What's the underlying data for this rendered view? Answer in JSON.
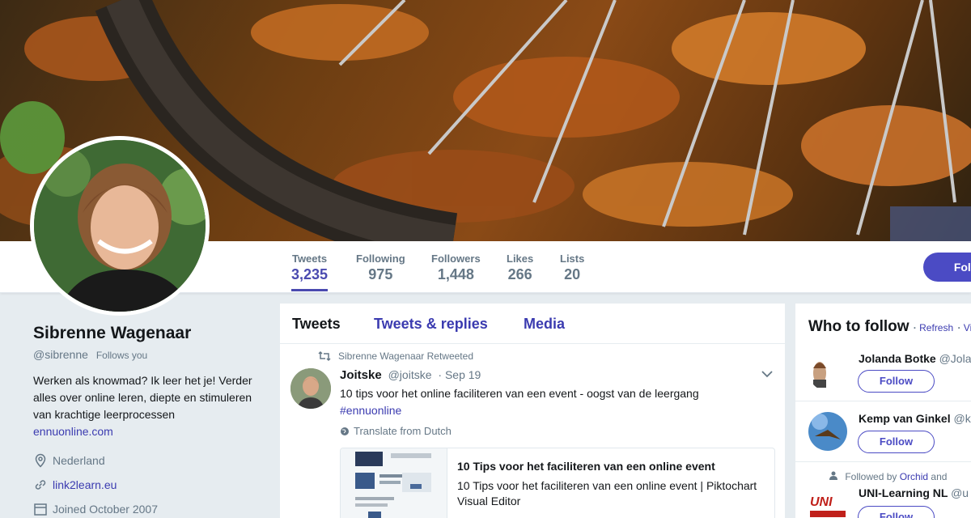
{
  "stats": [
    {
      "label": "Tweets",
      "value": "3,235"
    },
    {
      "label": "Following",
      "value": "975"
    },
    {
      "label": "Followers",
      "value": "1,448"
    },
    {
      "label": "Likes",
      "value": "266"
    },
    {
      "label": "Lists",
      "value": "20"
    }
  ],
  "header": {
    "follow_label": "Follow"
  },
  "profile": {
    "name": "Sibrenne Wagenaar",
    "handle": "@sibrenne",
    "follows_you": "Follows you",
    "bio": "Werken als knowmad? Ik leer het je! Verder alles over online leren, diepte en stimuleren van krachtige leerprocessen",
    "bio_link": "ennuonline.com",
    "location": "Nederland",
    "website": "link2learn.eu",
    "joined": "Joined October 2007"
  },
  "timeline": {
    "tabs": [
      "Tweets",
      "Tweets & replies",
      "Media"
    ],
    "tweet": {
      "retweeted_by": "Sibrenne Wagenaar Retweeted",
      "author_name": "Joitske",
      "author_handle": "@joitske",
      "date": "· Sep 19",
      "text": "10 tips voor het online faciliteren van een event - oogst van de leergang",
      "hashtag": "#ennuonline",
      "translate": "Translate from Dutch",
      "card_title": "10 Tips voor het faciliteren van een online event",
      "card_desc": "10 Tips voor het faciliteren van een online event | Piktochart Visual Editor"
    }
  },
  "who_to_follow": {
    "title": "Who to follow",
    "refresh": "Refresh",
    "view_all": "Vi",
    "suggestions": [
      {
        "name": "Jolanda Botke",
        "handle": "@Jola",
        "button": "Follow"
      },
      {
        "name": "Kemp van Ginkel",
        "handle": "@k",
        "button": "Follow"
      },
      {
        "name": "UNI-Learning NL",
        "handle": "@u",
        "followed_by_prefix": "Followed by",
        "followed_by_link": "Orchid",
        "followed_by_suffix": "and",
        "button": "Follow"
      }
    ]
  },
  "colors": {
    "accent": "#4b4bc4",
    "link": "#3b3bb0",
    "muted": "#657786",
    "background": "#e6ecf0"
  }
}
